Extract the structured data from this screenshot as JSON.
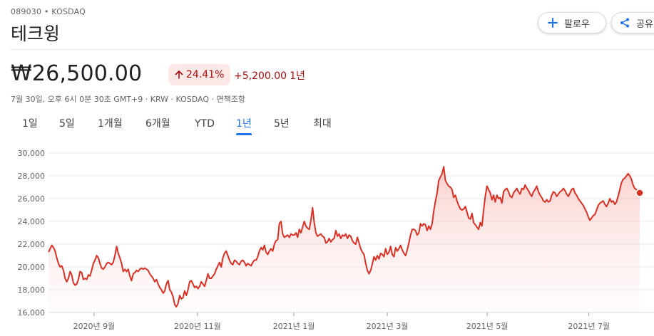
{
  "header": {
    "ticker": "089030 • KOSDAQ",
    "name": "테크윙",
    "follow_label": "팔로우",
    "share_label": "공유"
  },
  "quote": {
    "price": "₩26,500.00",
    "percent_change": "24.41%",
    "abs_change": "+5,200.00",
    "period": "1년",
    "meta": "7월 30일, 오후 6시 0분 30초 GMT+9 · KRW · KOSDAQ · 면책조항",
    "trend_color": "#a50e0e"
  },
  "tabs": [
    {
      "label": "1일",
      "active": false
    },
    {
      "label": "5일",
      "active": false
    },
    {
      "label": "1개월",
      "active": false
    },
    {
      "label": "6개월",
      "active": false
    },
    {
      "label": "YTD",
      "active": false
    },
    {
      "label": "1년",
      "active": true
    },
    {
      "label": "5년",
      "active": false
    },
    {
      "label": "최대",
      "active": false
    }
  ],
  "icons": {
    "follow": "plus-icon",
    "share": "share-icon",
    "trend": "arrow-up-icon"
  },
  "chart_data": {
    "type": "area",
    "line_color": "#d93025",
    "fill_color": "#fce8e6",
    "ylim": [
      16000,
      30000
    ],
    "yticks": [
      "30,000",
      "28,000",
      "26,000",
      "24,000",
      "22,000",
      "20,000",
      "18,000",
      "16,000"
    ],
    "xticks": [
      {
        "label": "2020년 9월",
        "t": 0.077
      },
      {
        "label": "2020년 11월",
        "t": 0.252
      },
      {
        "label": "2021년 1월",
        "t": 0.415
      },
      {
        "label": "2021년 3월",
        "t": 0.573
      },
      {
        "label": "2021년 5월",
        "t": 0.742
      },
      {
        "label": "2021년 7월",
        "t": 0.914
      }
    ],
    "values": [
      21300,
      21600,
      21900,
      21700,
      21400,
      20800,
      20300,
      20000,
      20100,
      19700,
      19000,
      18700,
      19000,
      19600,
      19300,
      18600,
      18400,
      18500,
      18900,
      19600,
      19500,
      18900,
      19000,
      18900,
      19300,
      19200,
      19700,
      20300,
      20600,
      21000,
      20800,
      20300,
      19900,
      19800,
      20000,
      20300,
      20400,
      20300,
      20200,
      20400,
      21000,
      21800,
      21200,
      20800,
      20300,
      19600,
      19800,
      19600,
      19800,
      19200,
      18800,
      19400,
      19500,
      19700,
      19600,
      19800,
      19900,
      19800,
      19900,
      19800,
      19700,
      19400,
      19200,
      19000,
      18700,
      18900,
      18500,
      18200,
      18000,
      17700,
      17900,
      18500,
      18800,
      18000,
      17800,
      17400,
      16700,
      16500,
      16800,
      17500,
      17200,
      17300,
      17900,
      17500,
      18000,
      18700,
      18800,
      18500,
      18200,
      18300,
      18100,
      18300,
      18700,
      18500,
      18300,
      18800,
      19400,
      19000,
      19000,
      19200,
      19400,
      19800,
      20100,
      20400,
      20000,
      20800,
      21200,
      21400,
      21000,
      20600,
      20300,
      20200,
      20600,
      20500,
      20300,
      20200,
      20500,
      20600,
      20400,
      20100,
      20300,
      20200,
      20100,
      20400,
      20600,
      20600,
      20900,
      21400,
      21700,
      21500,
      21900,
      21300,
      21100,
      21400,
      21600,
      21400,
      22000,
      22300,
      22400,
      23800,
      24000,
      22900,
      22600,
      22700,
      22800,
      22600,
      22900,
      22800,
      22800,
      23000,
      22600,
      23300,
      23000,
      23500,
      24000,
      23600,
      23400,
      23300,
      24100,
      25200,
      23900,
      23000,
      22700,
      22800,
      22900,
      22700,
      22600,
      22100,
      22200,
      22500,
      22200,
      22400,
      22500,
      23200,
      22700,
      22900,
      22500,
      22800,
      22700,
      22900,
      22500,
      22800,
      22700,
      22300,
      22100,
      22000,
      22600,
      22100,
      21600,
      21300,
      21100,
      20300,
      19700,
      19400,
      19700,
      20300,
      20900,
      20600,
      21000,
      20700,
      21200,
      21100,
      20900,
      21600,
      21100,
      21300,
      21800,
      21100,
      20900,
      21700,
      21400,
      21600,
      21900,
      21500,
      21200,
      21000,
      21500,
      22100,
      22800,
      23300,
      23300,
      23200,
      22800,
      23000,
      23800,
      23600,
      23800,
      23700,
      23200,
      23600,
      23300,
      23800,
      24900,
      25800,
      26500,
      27600,
      27900,
      28200,
      28800,
      27600,
      27300,
      27100,
      27000,
      26800,
      26100,
      26300,
      25800,
      25400,
      25100,
      25000,
      25100,
      25300,
      24800,
      24300,
      24200,
      24700,
      23900,
      23700,
      23500,
      23300,
      23900,
      23600,
      25000,
      26200,
      27100,
      26800,
      26500,
      25900,
      26300,
      25700,
      26300,
      26000,
      26100,
      25600,
      26600,
      26800,
      26900,
      26600,
      26200,
      26100,
      26500,
      26700,
      26900,
      26600,
      26400,
      26900,
      26800,
      27200,
      26900,
      26700,
      26400,
      26200,
      26600,
      26800,
      27100,
      26600,
      26300,
      26100,
      25800,
      25700,
      25900,
      25700,
      25800,
      26300,
      26600,
      26500,
      26200,
      26400,
      26600,
      26700,
      26900,
      26700,
      26400,
      26200,
      26500,
      26800,
      26900,
      26500,
      26300,
      26000,
      25800,
      25600,
      25400,
      25100,
      24800,
      24400,
      24100,
      24300,
      24500,
      24600,
      25000,
      25400,
      25600,
      25700,
      25800,
      25500,
      25300,
      25600,
      26000,
      25700,
      25800,
      25500,
      25700,
      26200,
      26800,
      27400,
      27700,
      27800,
      28000,
      28200,
      28000,
      27700,
      27200,
      26900,
      26800,
      26600,
      26500
    ]
  }
}
